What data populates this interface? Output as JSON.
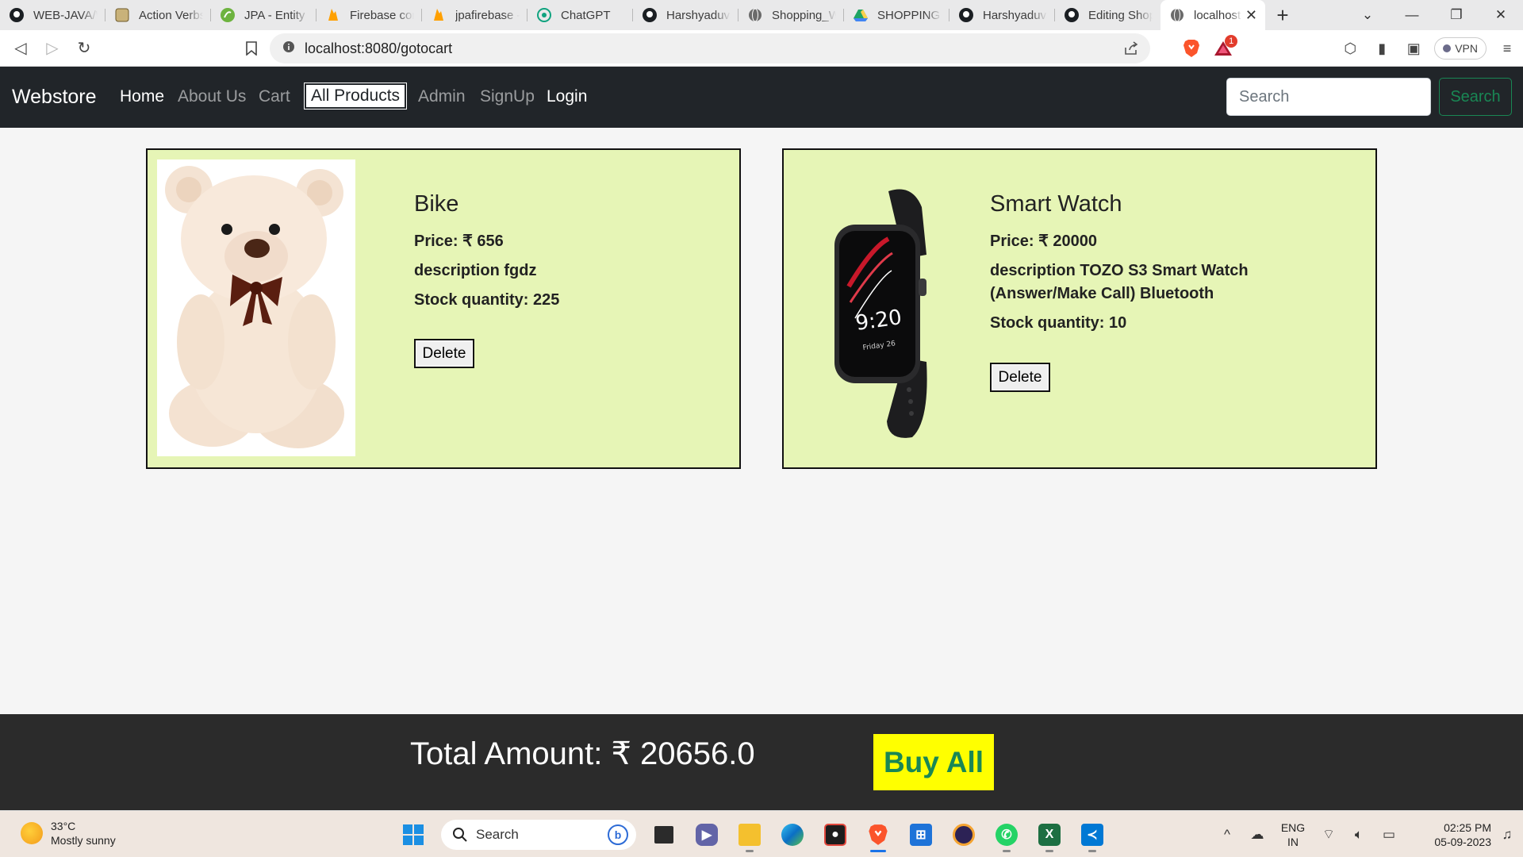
{
  "browser": {
    "tabs": [
      {
        "title": "WEB-JAVA/W",
        "icon": "github-icon"
      },
      {
        "title": "Action Verbs",
        "icon": "site-icon"
      },
      {
        "title": "JPA - Entity R",
        "icon": "spring-icon"
      },
      {
        "title": "Firebase con",
        "icon": "firebase-icon"
      },
      {
        "title": "jpafirebase -",
        "icon": "firebase-icon"
      },
      {
        "title": "ChatGPT",
        "icon": "chatgpt-icon"
      },
      {
        "title": "Harshyaduva",
        "icon": "github-icon"
      },
      {
        "title": "Shopping_W",
        "icon": "globe-icon"
      },
      {
        "title": "SHOPPING A",
        "icon": "drive-icon"
      },
      {
        "title": "Harshyaduva",
        "icon": "github-icon"
      },
      {
        "title": "Editing Shop",
        "icon": "github-icon"
      },
      {
        "title": "localhost",
        "icon": "globe-icon",
        "active": true
      }
    ],
    "new_tab": "+",
    "url": "localhost:8080/gotocart",
    "vpn_label": "VPN",
    "notification_count": "1"
  },
  "navbar": {
    "brand": "Webstore",
    "links": {
      "home": "Home",
      "about": "About Us",
      "cart": "Cart",
      "all_products": "All Products",
      "admin": "Admin",
      "signup": "SignUp",
      "login": "Login"
    },
    "search_placeholder": "Search",
    "search_button": "Search"
  },
  "products": [
    {
      "name": "Bike",
      "price": "Price: ₹ 656",
      "description": "description fgdz",
      "stock": "Stock quantity: 225",
      "delete_label": "Delete",
      "image": "teddy-bear-image"
    },
    {
      "name": "Smart Watch",
      "price": "Price: ₹ 20000",
      "description_line1": "description TOZO S3 Smart Watch",
      "description_line2": "(Answer/Make Call) Bluetooth",
      "stock": "Stock quantity: 10",
      "delete_label": "Delete",
      "image": "smart-watch-image"
    }
  ],
  "footer": {
    "total": "Total Amount: ₹ 20656.0",
    "buy_all": "Buy All"
  },
  "taskbar": {
    "weather_temp": "33°C",
    "weather_desc": "Mostly sunny",
    "search_label": "Search",
    "lang_line1": "ENG",
    "lang_line2": "IN",
    "time": "02:25 PM",
    "date": "05-09-2023"
  },
  "colors": {
    "navbar_bg": "#212529",
    "card_bg": "#e6f5b6",
    "footer_bg": "#2b2b2b",
    "buy_button_bg": "#ffff00",
    "buy_button_text": "#198754",
    "search_button": "#198754"
  }
}
